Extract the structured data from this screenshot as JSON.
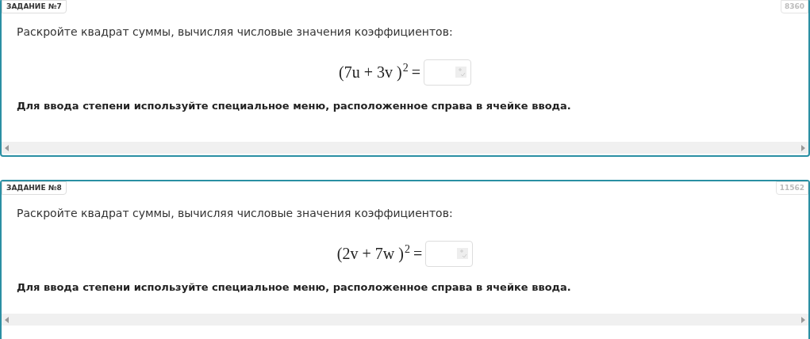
{
  "tasks": [
    {
      "label": "ЗАДАНИЕ №7",
      "id": "8360",
      "prompt": "Раскройте квадрат суммы, вычисляя числовые значения коэффициентов:",
      "formula": "(7u + 3v )",
      "exponent": "2",
      "equals": "=",
      "note": "Для ввода степени используйте специальное меню, расположенное справа в ячейке ввода."
    },
    {
      "label": "ЗАДАНИЕ №8",
      "id": "11562",
      "prompt": "Раскройте квадрат суммы, вычисляя числовые значения коэффициентов:",
      "formula": "(2v + 7w )",
      "exponent": "2",
      "equals": "=",
      "note": "Для ввода степени используйте специальное меню, расположенное справа в ячейке ввода."
    }
  ]
}
